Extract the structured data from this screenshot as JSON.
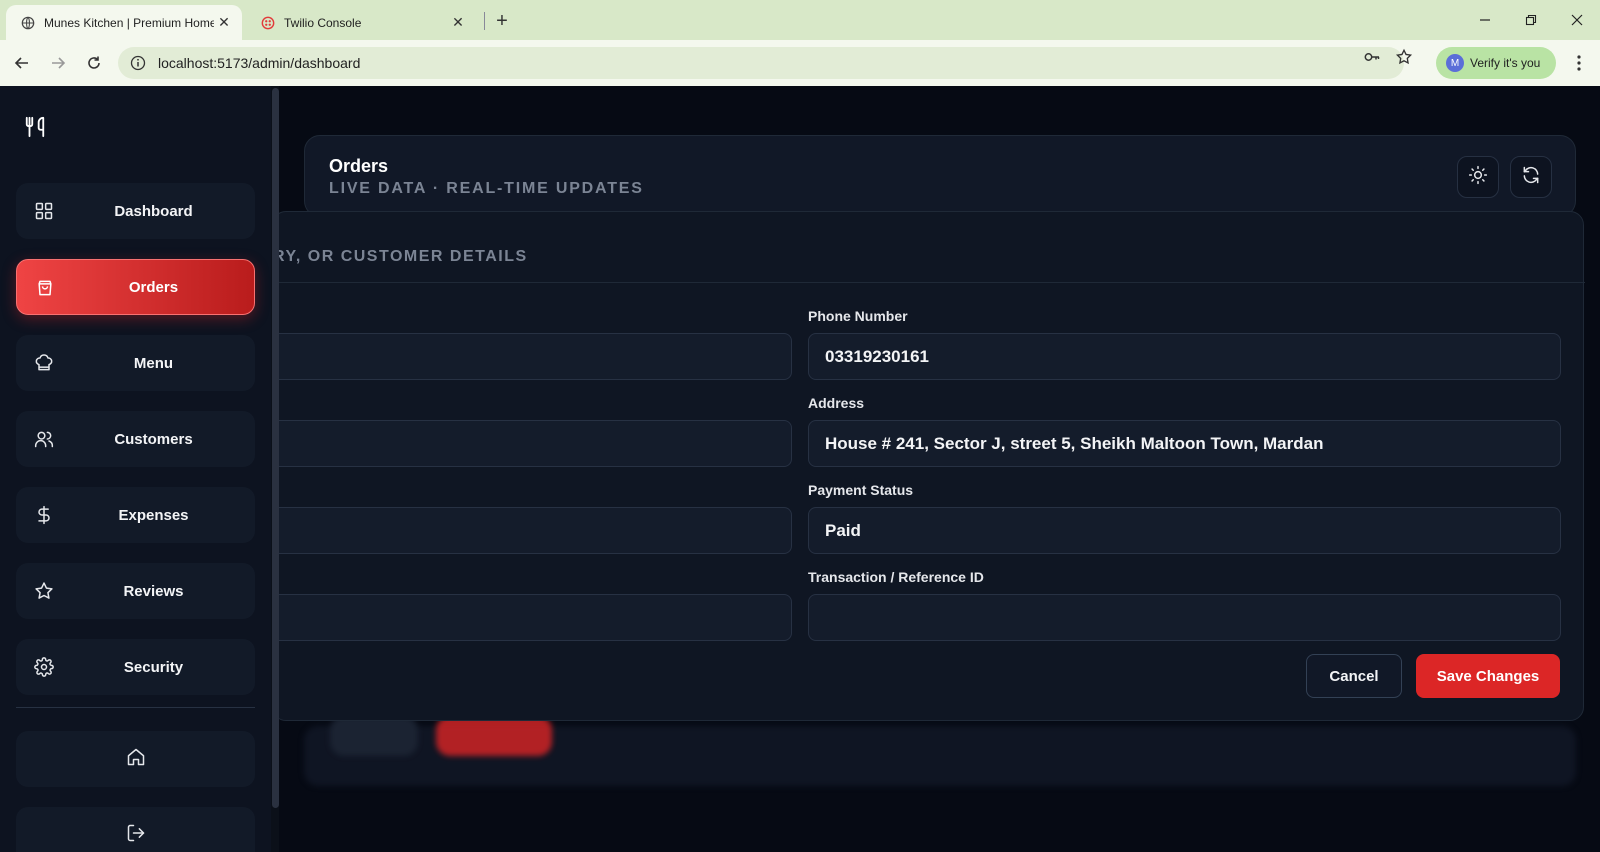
{
  "browser": {
    "tabs": [
      {
        "title": "Munes Kitchen | Premium Home",
        "active": true
      },
      {
        "title": "Twilio Console",
        "active": false
      }
    ],
    "url": "localhost:5173/admin/dashboard",
    "profile_initial": "M",
    "verify_label": "Verify it's you"
  },
  "sidebar": {
    "items": [
      {
        "label": "Dashboard",
        "icon": "grid-icon",
        "active": false
      },
      {
        "label": "Orders",
        "icon": "shopping-bag-icon",
        "active": true
      },
      {
        "label": "Menu",
        "icon": "chef-hat-icon",
        "active": false
      },
      {
        "label": "Customers",
        "icon": "users-icon",
        "active": false
      },
      {
        "label": "Expenses",
        "icon": "dollar-icon",
        "active": false
      },
      {
        "label": "Reviews",
        "icon": "star-icon",
        "active": false
      },
      {
        "label": "Security",
        "icon": "gear-icon",
        "active": false
      }
    ],
    "bottom": [
      "home-icon",
      "logout-icon"
    ]
  },
  "header": {
    "title": "Orders",
    "subtitle": "LIVE DATA · REAL-TIME UPDATES"
  },
  "modal": {
    "subtitle_partial": "RY, OR CUSTOMER DETAILS",
    "fields": {
      "phone": {
        "label": "Phone Number",
        "value": "03319230161"
      },
      "address": {
        "label": "Address",
        "value": "House # 241, Sector J, street 5, Sheikh Maltoon Town, Mardan"
      },
      "payment_status": {
        "label": "Payment Status",
        "value": "Paid"
      },
      "transaction_id": {
        "label": "Transaction / Reference ID",
        "value": ""
      }
    },
    "cancel_label": "Cancel",
    "save_label": "Save Changes"
  },
  "colors": {
    "accent": "#dc2626",
    "background": "#060a14",
    "card": "#111827"
  }
}
